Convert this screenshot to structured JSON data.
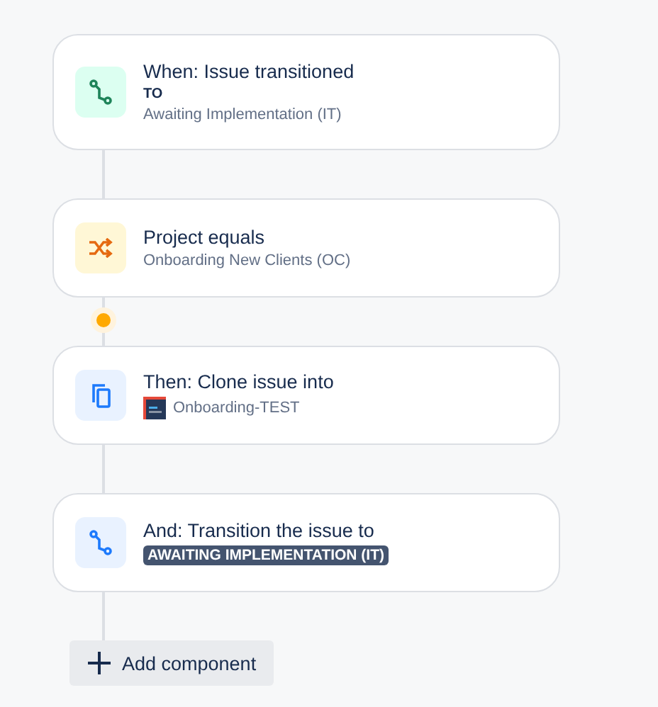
{
  "steps": [
    {
      "kind": "trigger",
      "title": "When: Issue transitioned",
      "details": [
        {
          "kind": "label",
          "text": "TO"
        },
        {
          "kind": "text",
          "text": "Awaiting Implementation (IT)"
        }
      ]
    },
    {
      "kind": "condition",
      "title": "Project equals",
      "details": [
        {
          "kind": "text",
          "text": "Onboarding New Clients (OC)"
        }
      ]
    },
    {
      "kind": "action",
      "title": "Then: Clone issue into",
      "details": [
        {
          "kind": "project",
          "text": "Onboarding-TEST"
        }
      ]
    },
    {
      "kind": "transition",
      "title": "And: Transition the issue to",
      "details": [
        {
          "kind": "status",
          "text": "AWAITING IMPLEMENTATION (IT)"
        }
      ]
    }
  ],
  "add_button": {
    "label": "Add component"
  }
}
